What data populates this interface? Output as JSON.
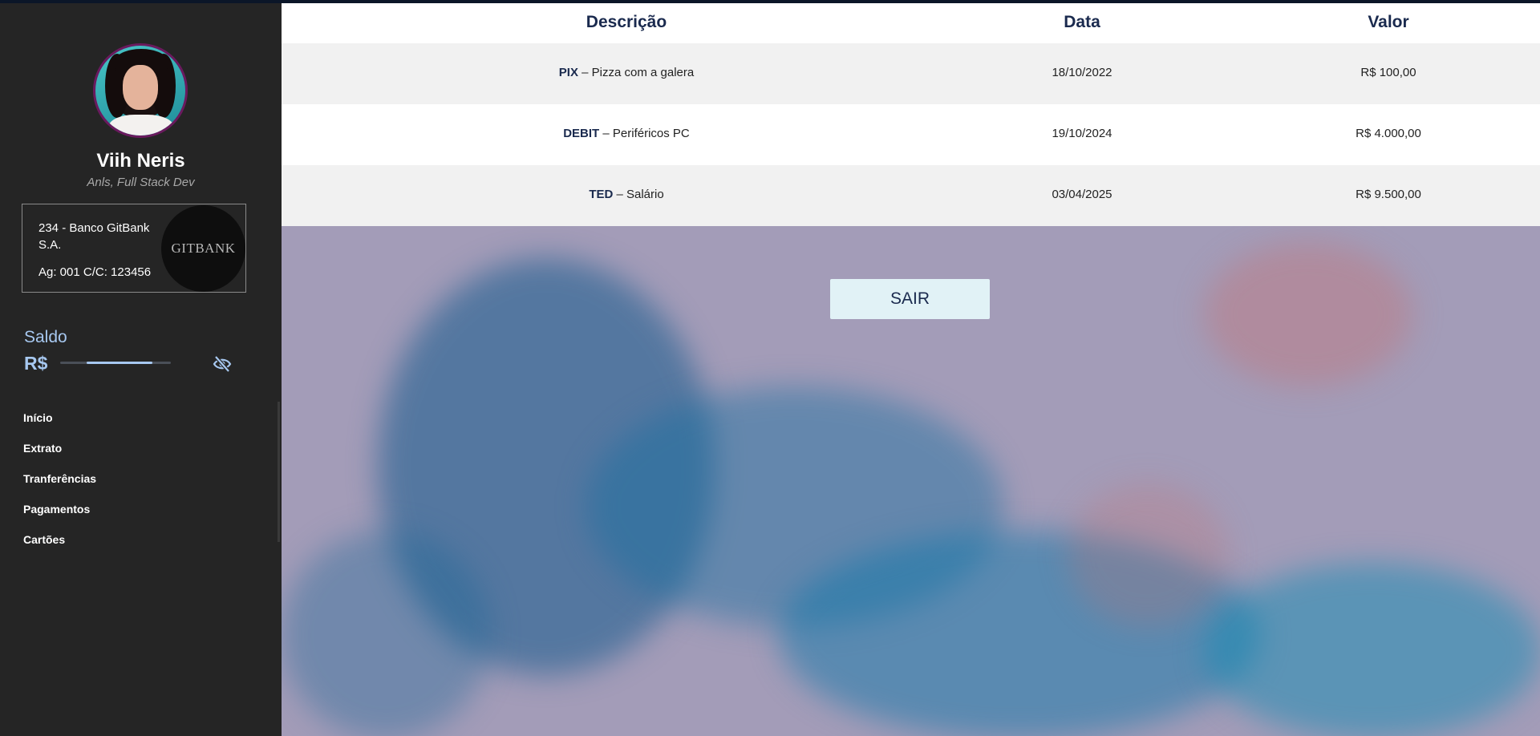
{
  "user": {
    "name": "Viih Neris",
    "role": "Anls, Full Stack Dev"
  },
  "bank": {
    "line1": "234 - Banco GitBank S.A.",
    "line2": "Ag: 001 C/C: 123456",
    "logo_text": "GITBANK"
  },
  "balance": {
    "label": "Saldo",
    "currency": "R$",
    "hidden": true,
    "toggle_icon": "eye-slash-icon"
  },
  "nav": {
    "items": [
      {
        "label": "Início"
      },
      {
        "label": "Extrato"
      },
      {
        "label": "Tranferências"
      },
      {
        "label": "Pagamentos"
      },
      {
        "label": "Cartões"
      }
    ]
  },
  "table": {
    "headers": {
      "description": "Descrição",
      "date": "Data",
      "value": "Valor"
    },
    "rows": [
      {
        "type": "PIX",
        "description": " – Pizza com a galera",
        "date": "18/10/2022",
        "value": "R$ 100,00"
      },
      {
        "type": "DEBIT",
        "description": " – Periféricos PC",
        "date": "19/10/2024",
        "value": "R$ 4.000,00"
      },
      {
        "type": "TED",
        "description": " – Salário",
        "date": "03/04/2025",
        "value": "R$ 9.500,00"
      }
    ]
  },
  "actions": {
    "logout_label": "SAIR"
  },
  "colors": {
    "sidebar_bg": "#252525",
    "accent": "#a7c8f0",
    "header_text": "#1a2a4e",
    "row_alt": "#f1f1f1",
    "button_bg": "#e1f2f6"
  }
}
